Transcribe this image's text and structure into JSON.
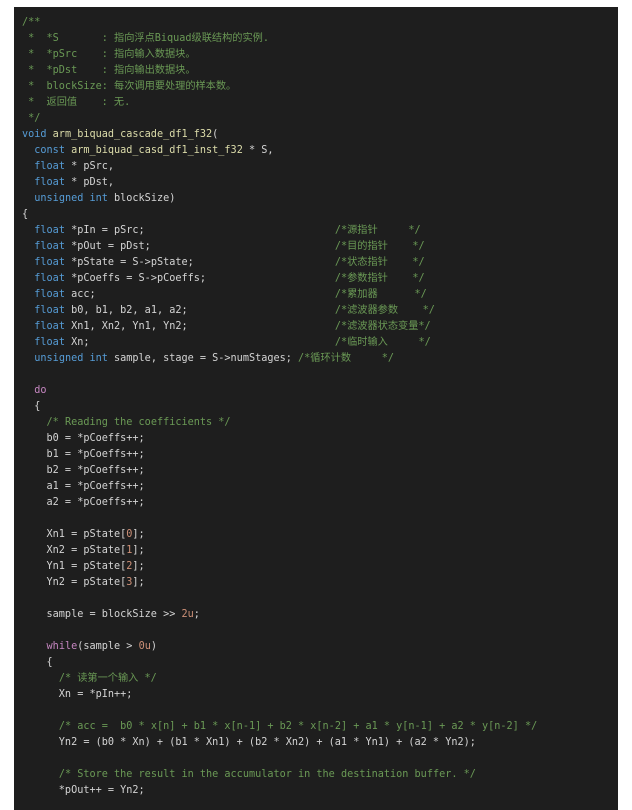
{
  "theme": {
    "background": "#1e1e1e",
    "page_background": "#ffffff",
    "comment": "#8a8a8a",
    "keyword": "#c586c0",
    "type": "#569cd6",
    "function": "#dcdcaa",
    "identifier": "#d4d4d4",
    "number": "#ce9178",
    "text": "#d4d4d4"
  },
  "code_lines": [
    [
      [
        "cm",
        "/**"
      ]
    ],
    [
      [
        "cm",
        " *  *S       : 指向浮点Biquad级联结构的实例."
      ]
    ],
    [
      [
        "cm",
        " *  *pSrc    : 指向输入数据块。"
      ]
    ],
    [
      [
        "cm",
        " *  *pDst    : 指向输出数据块。"
      ]
    ],
    [
      [
        "cm",
        " *  blockSize: 每次调用要处理的样本数。"
      ]
    ],
    [
      [
        "cm",
        " *  返回值    : 无."
      ]
    ],
    [
      [
        "cm",
        " */"
      ]
    ],
    [
      [
        "ty",
        "void "
      ],
      [
        "fn",
        "arm_biquad_cascade_df1_f32"
      ],
      [
        "pl",
        "("
      ]
    ],
    [
      [
        "pl",
        "  "
      ],
      [
        "ty",
        "const "
      ],
      [
        "fn",
        "arm_biquad_casd_df1_inst_f32"
      ],
      [
        "pl",
        " * S,"
      ]
    ],
    [
      [
        "pl",
        "  "
      ],
      [
        "ty",
        "float"
      ],
      [
        "pl",
        " * pSrc,"
      ]
    ],
    [
      [
        "pl",
        "  "
      ],
      [
        "ty",
        "float"
      ],
      [
        "pl",
        " * pDst,"
      ]
    ],
    [
      [
        "pl",
        "  "
      ],
      [
        "ty",
        "unsigned int "
      ],
      [
        "pl",
        "blockSize)"
      ]
    ],
    [
      [
        "pl",
        "{"
      ]
    ],
    [
      [
        "pl",
        "  "
      ],
      [
        "ty",
        "float"
      ],
      [
        "pl",
        " *pIn = pSrc;                               "
      ],
      [
        "cm",
        "/*源指针     */"
      ]
    ],
    [
      [
        "pl",
        "  "
      ],
      [
        "ty",
        "float"
      ],
      [
        "pl",
        " *pOut = pDst;                              "
      ],
      [
        "cm",
        "/*目的指针    */"
      ]
    ],
    [
      [
        "pl",
        "  "
      ],
      [
        "ty",
        "float"
      ],
      [
        "pl",
        " *pState = S->pState;                       "
      ],
      [
        "cm",
        "/*状态指针    */"
      ]
    ],
    [
      [
        "pl",
        "  "
      ],
      [
        "ty",
        "float"
      ],
      [
        "pl",
        " *pCoeffs = S->pCoeffs;                     "
      ],
      [
        "cm",
        "/*参数指针    */"
      ]
    ],
    [
      [
        "pl",
        "  "
      ],
      [
        "ty",
        "float"
      ],
      [
        "pl",
        " acc;                                       "
      ],
      [
        "cm",
        "/*累加器      */"
      ]
    ],
    [
      [
        "pl",
        "  "
      ],
      [
        "ty",
        "float"
      ],
      [
        "pl",
        " b0, b1, b2, a1, a2;                        "
      ],
      [
        "cm",
        "/*滤波器参数    */"
      ]
    ],
    [
      [
        "pl",
        "  "
      ],
      [
        "ty",
        "float"
      ],
      [
        "pl",
        " Xn1, Xn2, Yn1, Yn2;                        "
      ],
      [
        "cm",
        "/*滤波器状态变量*/"
      ]
    ],
    [
      [
        "pl",
        "  "
      ],
      [
        "ty",
        "float"
      ],
      [
        "pl",
        " Xn;                                        "
      ],
      [
        "cm",
        "/*临时输入     */"
      ]
    ],
    [
      [
        "pl",
        "  "
      ],
      [
        "ty",
        "unsigned int "
      ],
      [
        "pl",
        "sample, stage = S->numStages; "
      ],
      [
        "cm",
        "/*循环计数     */"
      ]
    ],
    [
      [
        "pl",
        ""
      ]
    ],
    [
      [
        "pl",
        "  "
      ],
      [
        "kw",
        "do"
      ]
    ],
    [
      [
        "pl",
        "  {"
      ]
    ],
    [
      [
        "pl",
        "    "
      ],
      [
        "cm",
        "/* Reading the coefficients */"
      ]
    ],
    [
      [
        "pl",
        "    b0 = *pCoeffs++;"
      ]
    ],
    [
      [
        "pl",
        "    b1 = *pCoeffs++;"
      ]
    ],
    [
      [
        "pl",
        "    b2 = *pCoeffs++;"
      ]
    ],
    [
      [
        "pl",
        "    a1 = *pCoeffs++;"
      ]
    ],
    [
      [
        "pl",
        "    a2 = *pCoeffs++;"
      ]
    ],
    [
      [
        "pl",
        ""
      ]
    ],
    [
      [
        "pl",
        "    Xn1 = pState["
      ],
      [
        "idx",
        "0"
      ],
      [
        "pl",
        "];"
      ]
    ],
    [
      [
        "pl",
        "    Xn2 = pState["
      ],
      [
        "idx",
        "1"
      ],
      [
        "pl",
        "];"
      ]
    ],
    [
      [
        "pl",
        "    Yn1 = pState["
      ],
      [
        "idx",
        "2"
      ],
      [
        "pl",
        "];"
      ]
    ],
    [
      [
        "pl",
        "    Yn2 = pState["
      ],
      [
        "idx",
        "3"
      ],
      [
        "pl",
        "];"
      ]
    ],
    [
      [
        "pl",
        ""
      ]
    ],
    [
      [
        "pl",
        "    sample = blockSize >> "
      ],
      [
        "idx",
        "2u"
      ],
      [
        "pl",
        ";"
      ]
    ],
    [
      [
        "pl",
        ""
      ]
    ],
    [
      [
        "pl",
        "    "
      ],
      [
        "kw",
        "while"
      ],
      [
        "pl",
        "(sample > "
      ],
      [
        "idx",
        "0u"
      ],
      [
        "pl",
        ")"
      ]
    ],
    [
      [
        "pl",
        "    {"
      ]
    ],
    [
      [
        "pl",
        "      "
      ],
      [
        "cm",
        "/* 读第一个输入 */"
      ]
    ],
    [
      [
        "pl",
        "      Xn = *pIn++;"
      ]
    ],
    [
      [
        "pl",
        ""
      ]
    ],
    [
      [
        "pl",
        "      "
      ],
      [
        "cm",
        "/* acc =  b0 * x[n] + b1 * x[n-1] + b2 * x[n-2] + a1 * y[n-1] + a2 * y[n-2] */"
      ]
    ],
    [
      [
        "pl",
        "      Yn2 = (b0 * Xn) + (b1 * Xn1) + (b2 * Xn2) + (a1 * Yn1) + (a2 * Yn2);"
      ]
    ],
    [
      [
        "pl",
        ""
      ]
    ],
    [
      [
        "pl",
        "      "
      ],
      [
        "cm",
        "/* Store the result in the accumulator in the destination buffer. */"
      ]
    ],
    [
      [
        "pl",
        "      *pOut++ = Yn2;"
      ]
    ]
  ]
}
